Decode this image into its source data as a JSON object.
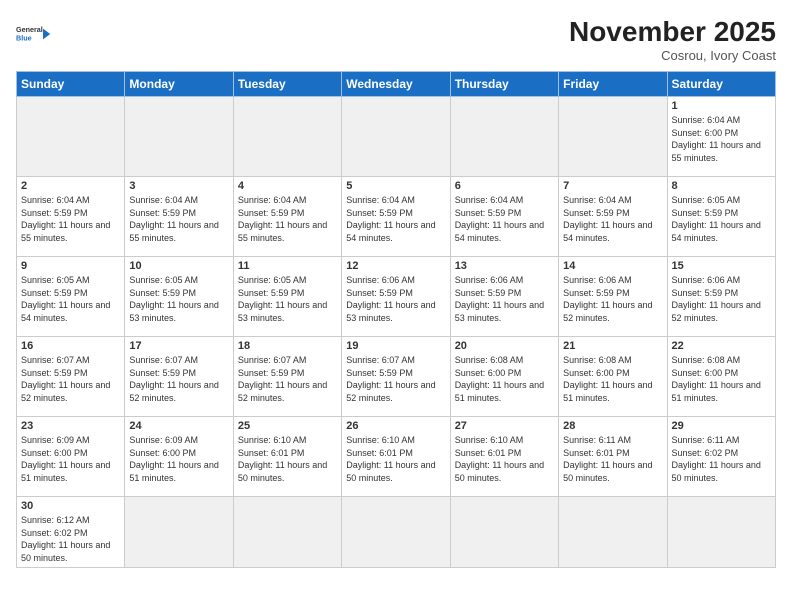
{
  "header": {
    "logo_general": "General",
    "logo_blue": "Blue",
    "month_title": "November 2025",
    "location": "Cosrou, Ivory Coast"
  },
  "weekdays": [
    "Sunday",
    "Monday",
    "Tuesday",
    "Wednesday",
    "Thursday",
    "Friday",
    "Saturday"
  ],
  "days": {
    "1": {
      "sunrise": "6:04 AM",
      "sunset": "6:00 PM",
      "daylight": "11 hours and 55 minutes."
    },
    "2": {
      "sunrise": "6:04 AM",
      "sunset": "5:59 PM",
      "daylight": "11 hours and 55 minutes."
    },
    "3": {
      "sunrise": "6:04 AM",
      "sunset": "5:59 PM",
      "daylight": "11 hours and 55 minutes."
    },
    "4": {
      "sunrise": "6:04 AM",
      "sunset": "5:59 PM",
      "daylight": "11 hours and 55 minutes."
    },
    "5": {
      "sunrise": "6:04 AM",
      "sunset": "5:59 PM",
      "daylight": "11 hours and 54 minutes."
    },
    "6": {
      "sunrise": "6:04 AM",
      "sunset": "5:59 PM",
      "daylight": "11 hours and 54 minutes."
    },
    "7": {
      "sunrise": "6:04 AM",
      "sunset": "5:59 PM",
      "daylight": "11 hours and 54 minutes."
    },
    "8": {
      "sunrise": "6:05 AM",
      "sunset": "5:59 PM",
      "daylight": "11 hours and 54 minutes."
    },
    "9": {
      "sunrise": "6:05 AM",
      "sunset": "5:59 PM",
      "daylight": "11 hours and 54 minutes."
    },
    "10": {
      "sunrise": "6:05 AM",
      "sunset": "5:59 PM",
      "daylight": "11 hours and 53 minutes."
    },
    "11": {
      "sunrise": "6:05 AM",
      "sunset": "5:59 PM",
      "daylight": "11 hours and 53 minutes."
    },
    "12": {
      "sunrise": "6:06 AM",
      "sunset": "5:59 PM",
      "daylight": "11 hours and 53 minutes."
    },
    "13": {
      "sunrise": "6:06 AM",
      "sunset": "5:59 PM",
      "daylight": "11 hours and 53 minutes."
    },
    "14": {
      "sunrise": "6:06 AM",
      "sunset": "5:59 PM",
      "daylight": "11 hours and 52 minutes."
    },
    "15": {
      "sunrise": "6:06 AM",
      "sunset": "5:59 PM",
      "daylight": "11 hours and 52 minutes."
    },
    "16": {
      "sunrise": "6:07 AM",
      "sunset": "5:59 PM",
      "daylight": "11 hours and 52 minutes."
    },
    "17": {
      "sunrise": "6:07 AM",
      "sunset": "5:59 PM",
      "daylight": "11 hours and 52 minutes."
    },
    "18": {
      "sunrise": "6:07 AM",
      "sunset": "5:59 PM",
      "daylight": "11 hours and 52 minutes."
    },
    "19": {
      "sunrise": "6:07 AM",
      "sunset": "5:59 PM",
      "daylight": "11 hours and 52 minutes."
    },
    "20": {
      "sunrise": "6:08 AM",
      "sunset": "6:00 PM",
      "daylight": "11 hours and 51 minutes."
    },
    "21": {
      "sunrise": "6:08 AM",
      "sunset": "6:00 PM",
      "daylight": "11 hours and 51 minutes."
    },
    "22": {
      "sunrise": "6:08 AM",
      "sunset": "6:00 PM",
      "daylight": "11 hours and 51 minutes."
    },
    "23": {
      "sunrise": "6:09 AM",
      "sunset": "6:00 PM",
      "daylight": "11 hours and 51 minutes."
    },
    "24": {
      "sunrise": "6:09 AM",
      "sunset": "6:00 PM",
      "daylight": "11 hours and 51 minutes."
    },
    "25": {
      "sunrise": "6:10 AM",
      "sunset": "6:01 PM",
      "daylight": "11 hours and 50 minutes."
    },
    "26": {
      "sunrise": "6:10 AM",
      "sunset": "6:01 PM",
      "daylight": "11 hours and 50 minutes."
    },
    "27": {
      "sunrise": "6:10 AM",
      "sunset": "6:01 PM",
      "daylight": "11 hours and 50 minutes."
    },
    "28": {
      "sunrise": "6:11 AM",
      "sunset": "6:01 PM",
      "daylight": "11 hours and 50 minutes."
    },
    "29": {
      "sunrise": "6:11 AM",
      "sunset": "6:02 PM",
      "daylight": "11 hours and 50 minutes."
    },
    "30": {
      "sunrise": "6:12 AM",
      "sunset": "6:02 PM",
      "daylight": "11 hours and 50 minutes."
    }
  }
}
